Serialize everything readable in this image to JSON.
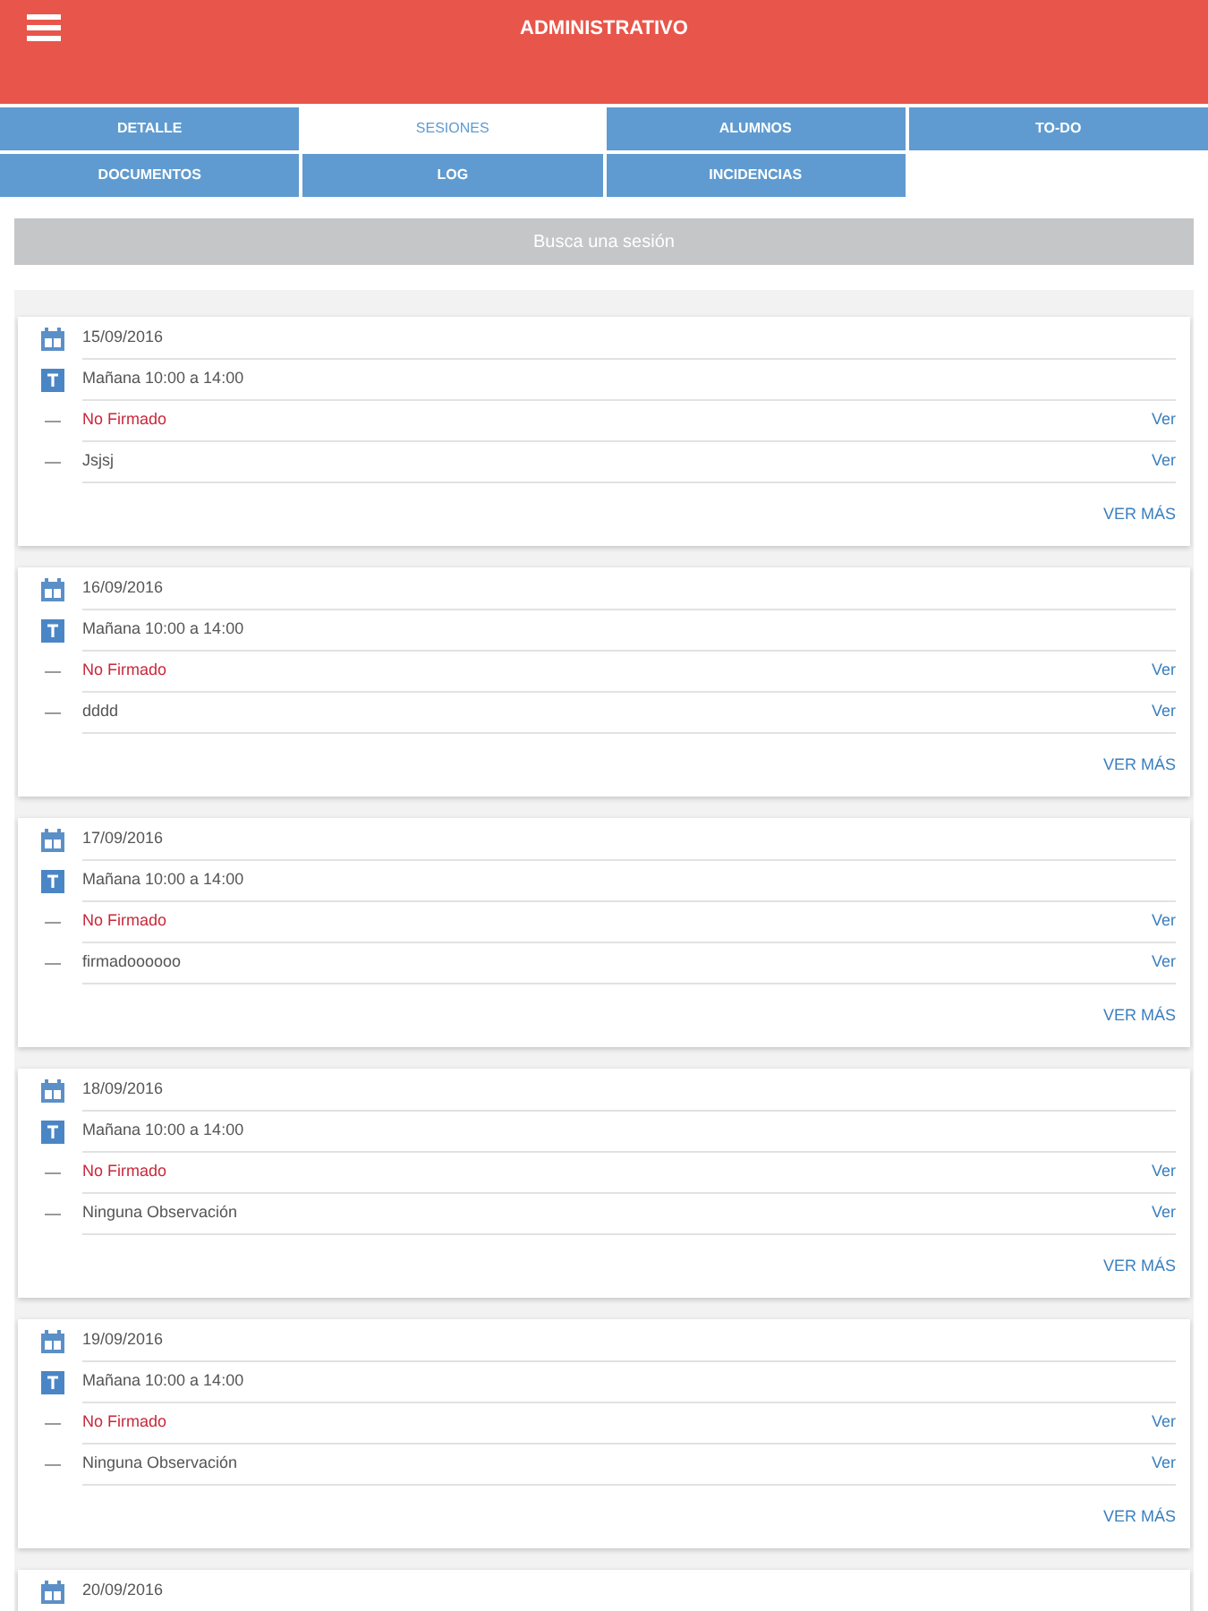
{
  "header": {
    "title": "ADMINISTRATIVO"
  },
  "tabs": [
    {
      "label": "DETALLE",
      "selected": false
    },
    {
      "label": "SESIONES",
      "selected": true
    },
    {
      "label": "ALUMNOS",
      "selected": false
    },
    {
      "label": "TO-DO",
      "selected": false
    },
    {
      "label": "DOCUMENTOS",
      "selected": false
    },
    {
      "label": "LOG",
      "selected": false
    },
    {
      "label": "INCIDENCIAS",
      "selected": false
    }
  ],
  "search": {
    "placeholder": "Busca una sesión"
  },
  "sessions": [
    {
      "rows": [
        {
          "kind": "date",
          "text": "15/09/2016"
        },
        {
          "kind": "shift",
          "text": "Mañana 10:00 a 14:00"
        },
        {
          "kind": "signature",
          "text": "No Firmado",
          "link": "Ver"
        },
        {
          "kind": "note",
          "text": "Jsjsj",
          "link": "Ver"
        }
      ],
      "more": "VER MÁS"
    },
    {
      "rows": [
        {
          "kind": "date",
          "text": "16/09/2016"
        },
        {
          "kind": "shift",
          "text": "Mañana 10:00 a 14:00"
        },
        {
          "kind": "signature",
          "text": "No Firmado",
          "link": "Ver"
        },
        {
          "kind": "note",
          "text": "dddd",
          "link": "Ver"
        }
      ],
      "more": "VER MÁS"
    },
    {
      "rows": [
        {
          "kind": "date",
          "text": "17/09/2016"
        },
        {
          "kind": "shift",
          "text": "Mañana 10:00 a 14:00"
        },
        {
          "kind": "signature",
          "text": "No Firmado",
          "link": "Ver"
        },
        {
          "kind": "note",
          "text": "firmadoooooo",
          "link": "Ver"
        }
      ],
      "more": "VER MÁS"
    },
    {
      "rows": [
        {
          "kind": "date",
          "text": "18/09/2016"
        },
        {
          "kind": "shift",
          "text": "Mañana 10:00 a 14:00"
        },
        {
          "kind": "signature",
          "text": "No Firmado",
          "link": "Ver"
        },
        {
          "kind": "note",
          "text": "Ninguna Observación",
          "link": "Ver"
        }
      ],
      "more": "VER MÁS"
    },
    {
      "rows": [
        {
          "kind": "date",
          "text": "19/09/2016"
        },
        {
          "kind": "shift",
          "text": "Mañana 10:00 a 14:00"
        },
        {
          "kind": "signature",
          "text": "No Firmado",
          "link": "Ver"
        },
        {
          "kind": "note",
          "text": "Ninguna Observación",
          "link": "Ver"
        }
      ],
      "more": "VER MÁS"
    },
    {
      "rows": [
        {
          "kind": "date",
          "text": "20/09/2016"
        }
      ]
    }
  ]
}
